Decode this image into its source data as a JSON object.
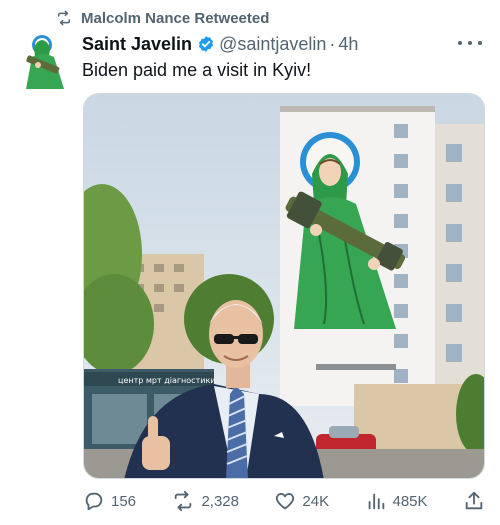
{
  "retweet_banner": {
    "text": "Malcolm Nance Retweeted"
  },
  "tweet": {
    "display_name": "Saint Javelin",
    "handle": "@saintjavelin",
    "separator": "·",
    "time": "4h",
    "text": "Biden paid me a visit in Kyiv!",
    "media": {
      "storefront_sign": "центр мрт діагностики"
    }
  },
  "actions": {
    "replies": "156",
    "retweets": "2,328",
    "likes": "24K",
    "views": "485K"
  },
  "colors": {
    "text_primary": "#0f1419",
    "text_secondary": "#536471",
    "verified_blue": "#1d9bf0",
    "border": "#cfd9de"
  },
  "icons": {
    "retweet_banner": "retweet-icon",
    "verified": "verified-badge-icon",
    "more": "more-options-icon",
    "reply": "reply-icon",
    "retweet": "retweet-icon",
    "like": "heart-icon",
    "views": "views-icon",
    "share": "share-icon"
  }
}
